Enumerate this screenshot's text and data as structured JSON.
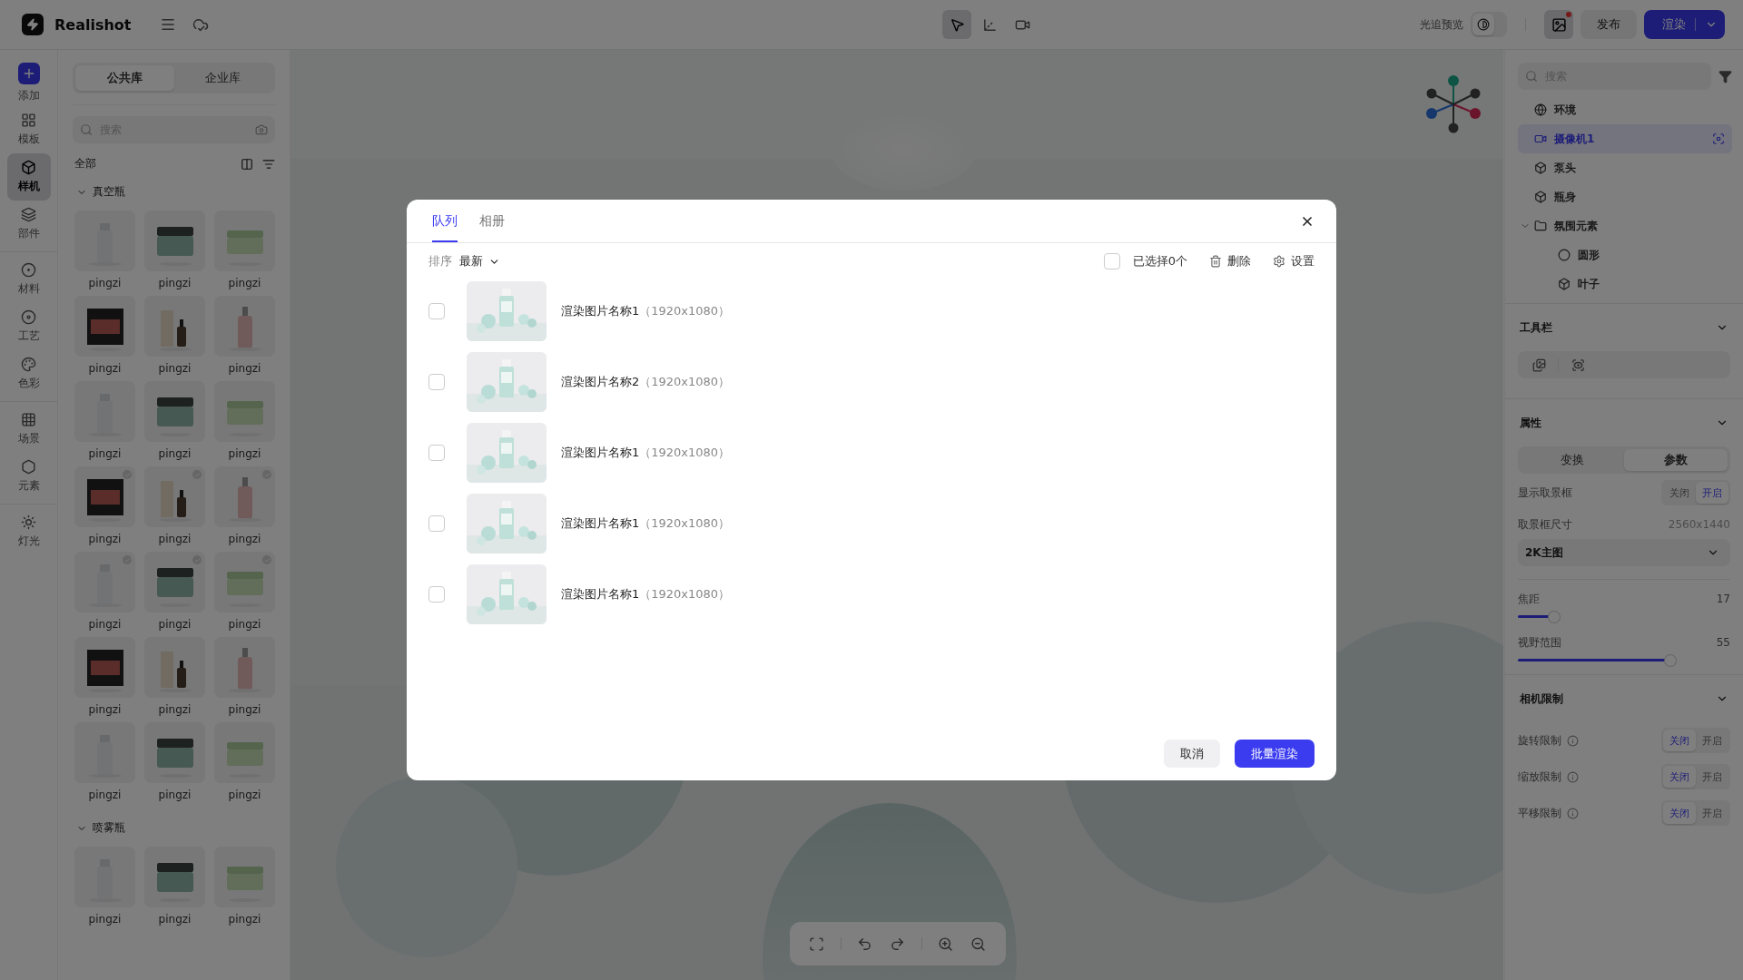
{
  "app": {
    "name": "Realishot"
  },
  "top_tools": [
    {
      "kind": "pointer",
      "selected": true
    },
    {
      "kind": "axis",
      "selected": false
    },
    {
      "kind": "camera",
      "selected": false
    }
  ],
  "ray_preview": {
    "label": "光追预览",
    "on": false
  },
  "gallery_button": {
    "unread": true
  },
  "publish": "发布",
  "render": "渲染",
  "rail_groups": [
    [
      {
        "kind": "add",
        "label": "添加",
        "selected": false
      },
      {
        "kind": "template",
        "label": "模板",
        "selected": false
      },
      {
        "kind": "mockup",
        "label": "样机",
        "selected": true
      },
      {
        "kind": "parts",
        "label": "部件",
        "selected": false
      }
    ],
    [
      {
        "kind": "material",
        "label": "材料",
        "selected": false
      },
      {
        "kind": "craft",
        "label": "工艺",
        "selected": false
      },
      {
        "kind": "color",
        "label": "色彩",
        "selected": false
      }
    ],
    [
      {
        "kind": "scene",
        "label": "场景",
        "selected": false
      },
      {
        "kind": "element",
        "label": "元素",
        "selected": false
      }
    ],
    [
      {
        "kind": "light",
        "label": "灯光",
        "selected": false
      }
    ]
  ],
  "library": {
    "tabs": [
      {
        "label": "公共库",
        "selected": true
      },
      {
        "label": "企业库",
        "selected": false
      }
    ],
    "search_placeholder": "搜索",
    "filter_label": "全部",
    "sections": [
      {
        "title": "真空瓶",
        "expanded": true,
        "items": [
          {
            "label": "pingzi",
            "marked": false
          },
          {
            "label": "pingzi",
            "marked": false
          },
          {
            "label": "pingzi",
            "marked": false
          },
          {
            "label": "pingzi",
            "marked": false
          },
          {
            "label": "pingzi",
            "marked": false
          },
          {
            "label": "pingzi",
            "marked": false
          },
          {
            "label": "pingzi",
            "marked": false
          },
          {
            "label": "pingzi",
            "marked": false
          },
          {
            "label": "pingzi",
            "marked": false
          },
          {
            "label": "pingzi",
            "marked": true
          },
          {
            "label": "pingzi",
            "marked": true
          },
          {
            "label": "pingzi",
            "marked": true
          },
          {
            "label": "pingzi",
            "marked": true
          },
          {
            "label": "pingzi",
            "marked": true
          },
          {
            "label": "pingzi",
            "marked": true
          },
          {
            "label": "pingzi",
            "marked": false
          },
          {
            "label": "pingzi",
            "marked": false
          },
          {
            "label": "pingzi",
            "marked": false
          },
          {
            "label": "pingzi",
            "marked": false
          },
          {
            "label": "pingzi",
            "marked": false
          },
          {
            "label": "pingzi",
            "marked": false
          }
        ]
      },
      {
        "title": "喷雾瓶",
        "expanded": true,
        "items": [
          {
            "label": "pingzi",
            "marked": false
          },
          {
            "label": "pingzi",
            "marked": false
          },
          {
            "label": "pingzi",
            "marked": false
          }
        ]
      }
    ]
  },
  "view_controls": [
    {
      "kind": "fit"
    },
    {
      "kind": "undo"
    },
    {
      "kind": "redo"
    },
    {
      "kind": "zoom-in"
    },
    {
      "kind": "zoom-out"
    }
  ],
  "scene": {
    "search_placeholder": "搜索",
    "tree": [
      {
        "label": "环境",
        "kind": "globe",
        "selected": false
      },
      {
        "label": "摄像机1",
        "kind": "camera",
        "selected": true
      },
      {
        "label": "泵头",
        "kind": "object",
        "selected": false
      },
      {
        "label": "瓶身",
        "kind": "object",
        "selected": false
      },
      {
        "label": "氛围元素",
        "kind": "folder",
        "selected": false,
        "expanded": true,
        "children": [
          {
            "label": "圆形",
            "kind": "sphere",
            "selected": false
          },
          {
            "label": "叶子",
            "kind": "object",
            "selected": false
          }
        ]
      }
    ]
  },
  "toolbar_section": {
    "title": "工具栏",
    "expanded": true
  },
  "properties": {
    "title": "属性",
    "expanded": true,
    "tabs": [
      {
        "label": "变换",
        "selected": false
      },
      {
        "label": "参数",
        "selected": true
      }
    ],
    "frame_toggle": {
      "label": "显示取景框",
      "options": [
        {
          "label": "关闭",
          "selected": false
        },
        {
          "label": "开启",
          "selected": true
        }
      ]
    },
    "frame_size": {
      "label": "取景框尺寸",
      "value": "2560x1440"
    },
    "preset": "2K主图",
    "sliders": [
      {
        "label": "焦距",
        "value": "17",
        "level": 0.15
      },
      {
        "label": "视野范围",
        "value": "55",
        "level": 0.73
      }
    ]
  },
  "camera_limits": {
    "title": "相机限制",
    "expanded": true,
    "rows": [
      {
        "label": "旋转限制",
        "options": [
          {
            "label": "关闭",
            "selected": true
          },
          {
            "label": "开启",
            "selected": false
          }
        ]
      },
      {
        "label": "缩放限制",
        "options": [
          {
            "label": "关闭",
            "selected": true
          },
          {
            "label": "开启",
            "selected": false
          }
        ]
      },
      {
        "label": "平移限制",
        "options": [
          {
            "label": "关闭",
            "selected": true
          },
          {
            "label": "开启",
            "selected": false
          }
        ]
      }
    ]
  },
  "dialog": {
    "tabs": [
      {
        "label": "队列",
        "selected": true
      },
      {
        "label": "相册",
        "selected": false
      }
    ],
    "sort_label": "排序",
    "sort_value": "最新",
    "select_all": {
      "label": "已选择0个",
      "checked": false
    },
    "actions": [
      {
        "kind": "delete",
        "label": "删除"
      },
      {
        "kind": "settings",
        "label": "设置"
      }
    ],
    "items": [
      {
        "name": "渲染图片名称1",
        "size": "（1920x1080）",
        "checked": false
      },
      {
        "name": "渲染图片名称2",
        "size": "（1920x1080）",
        "checked": false
      },
      {
        "name": "渲染图片名称1",
        "size": "（1920x1080）",
        "checked": false
      },
      {
        "name": "渲染图片名称1",
        "size": "（1920x1080）",
        "checked": false
      },
      {
        "name": "渲染图片名称1",
        "size": "（1920x1080）",
        "checked": false
      }
    ],
    "cancel": "取消",
    "confirm": "批量渲染"
  }
}
